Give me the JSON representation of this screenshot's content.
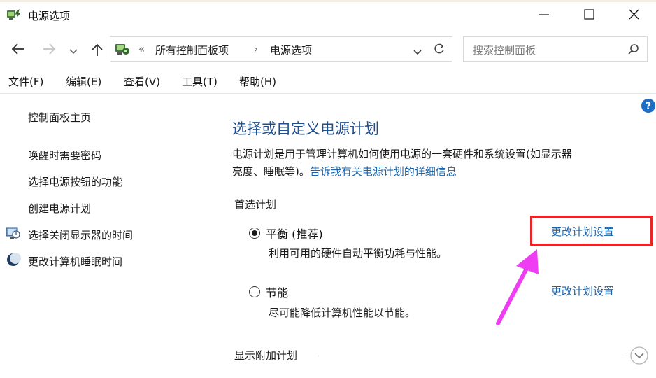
{
  "window": {
    "title": "电源选项"
  },
  "address": {
    "overflow": "«",
    "crumbs": [
      "所有控制面板项",
      "电源选项"
    ],
    "separator": "›"
  },
  "search": {
    "placeholder": "搜索控制面板"
  },
  "menu": [
    "文件(F)",
    "编辑(E)",
    "查看(V)",
    "工具(T)",
    "帮助(H)"
  ],
  "sidebar": {
    "home": "控制面板主页",
    "links": [
      "唤醒时需要密码",
      "选择电源按钮的功能",
      "创建电源计划",
      "选择关闭显示器的时间",
      "更改计算机睡眠时间"
    ]
  },
  "main": {
    "title": "选择或自定义电源计划",
    "description_line1": "电源计划是用于管理计算机如何使用电源的一套硬件和系统设置(如显示器",
    "description_line2": "亮度、睡眠等)。",
    "description_link": "告诉我有关电源计划的详细信息",
    "preferred_label": "首选计划",
    "plans": [
      {
        "name": "平衡 (推荐)",
        "description": "利用可用的硬件自动平衡功耗与性能。",
        "link": "更改计划设置",
        "selected": true
      },
      {
        "name": "节能",
        "description": "尽可能降低计算机性能以节能。",
        "link": "更改计划设置",
        "selected": false
      }
    ],
    "show_more_label": "显示附加计划"
  },
  "colors": {
    "accent": "#1a64ad",
    "title": "#1f4e8c",
    "highlight": "#e8262a",
    "arrow": "#ee3df2"
  },
  "icons": {
    "app": "power-options-icon",
    "address": "control-panel-icon",
    "help": "help-icon",
    "display": "monitor-clock-icon",
    "sleep": "moon-icon",
    "expand": "chevron-down-icon"
  }
}
